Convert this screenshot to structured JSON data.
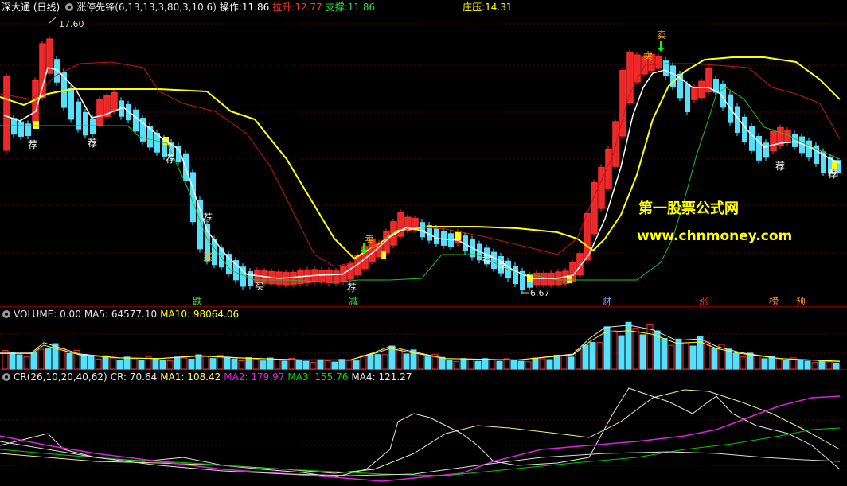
{
  "main_header": {
    "stock": "深大通 (日线)",
    "indicator": "涨停先锋(6,13,13,3,80,3,10,6)",
    "op_label": "操作:",
    "op_value": "11.86",
    "lift_label": "拉升:",
    "lift_value": "12.77",
    "support_label": "支撑:",
    "support_value": "11.86",
    "press_label": "庄压:",
    "press_value": "14.31"
  },
  "main_chart": {
    "high_label": "17.60",
    "low_label": "6.67",
    "tuijian": "荐",
    "mai_buy": "买",
    "mai_sell": "卖",
    "bottom_labels": [
      "跌",
      "减",
      "财",
      "涨",
      "榜",
      "预"
    ],
    "watermark_1": "第一股票公式网",
    "watermark_2": "www.chnmoney.com"
  },
  "volume_header": {
    "label": "VOLUME: 0.00",
    "ma5": "MA5: 64577.10",
    "ma10": "MA10: 98064.06"
  },
  "cr_header": {
    "label": "CR(26,10,20,40,62)",
    "cr": "CR: 70.64",
    "ma1": "MA1: 108.42",
    "ma2": "MA2: 179.97",
    "ma3": "MA3: 155.76",
    "ma4": "MA4: 121.27"
  },
  "colors": {
    "up": "#ff2b2b",
    "down": "#54e0ff",
    "yellow": "#ffff00",
    "white": "#ffffff",
    "red_line": "#c81414",
    "green": "#00c800",
    "magenta": "#e020e0",
    "cr_white": "#e6e6e6",
    "ma1": "#f0f090"
  }
}
